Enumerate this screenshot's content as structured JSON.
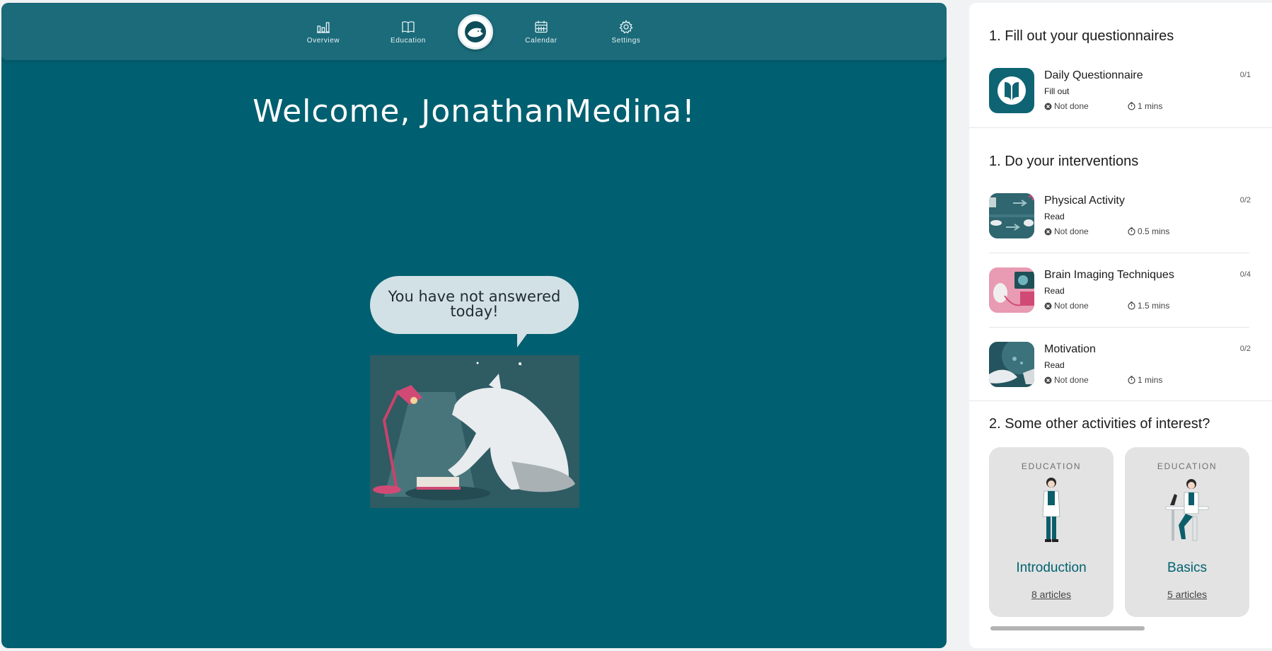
{
  "nav": {
    "items": [
      {
        "label": "Overview",
        "icon": "bar-chart-icon"
      },
      {
        "label": "Education",
        "icon": "book-icon"
      },
      {
        "label": "Calendar",
        "icon": "calendar-icon"
      },
      {
        "label": "Settings",
        "icon": "gear-icon"
      }
    ],
    "logo_icon": "wolf-logo-icon"
  },
  "main": {
    "welcome": "Welcome, JonathanMedina!",
    "bubble_text": "You have not answered today!"
  },
  "panel": {
    "questionnaires": {
      "title": "1. Fill out your questionnaires",
      "items": [
        {
          "title": "Daily Questionnaire",
          "action": "Fill out",
          "status": "Not done",
          "time": "1 mins",
          "count": "0/1"
        }
      ]
    },
    "interventions": {
      "title": "1. Do your interventions",
      "items": [
        {
          "title": "Physical Activity",
          "action": "Read",
          "status": "Not done",
          "time": "0.5 mins",
          "count": "0/2"
        },
        {
          "title": "Brain Imaging Techniques",
          "action": "Read",
          "status": "Not done",
          "time": "1.5 mins",
          "count": "0/4"
        },
        {
          "title": "Motivation",
          "action": "Read",
          "status": "Not done",
          "time": "1 mins",
          "count": "0/2"
        }
      ]
    },
    "other": {
      "title": "2. Some other activities of interest?",
      "cards": [
        {
          "kicker": "EDUCATION",
          "title": "Introduction",
          "link": "8 articles"
        },
        {
          "kicker": "EDUCATION",
          "title": "Basics",
          "link": "5 articles"
        }
      ]
    }
  },
  "colors": {
    "main_bg": "#005f70",
    "nav_bg": "#1b6b7a",
    "accent": "#00626f",
    "bubble": "#d2e1e5"
  }
}
